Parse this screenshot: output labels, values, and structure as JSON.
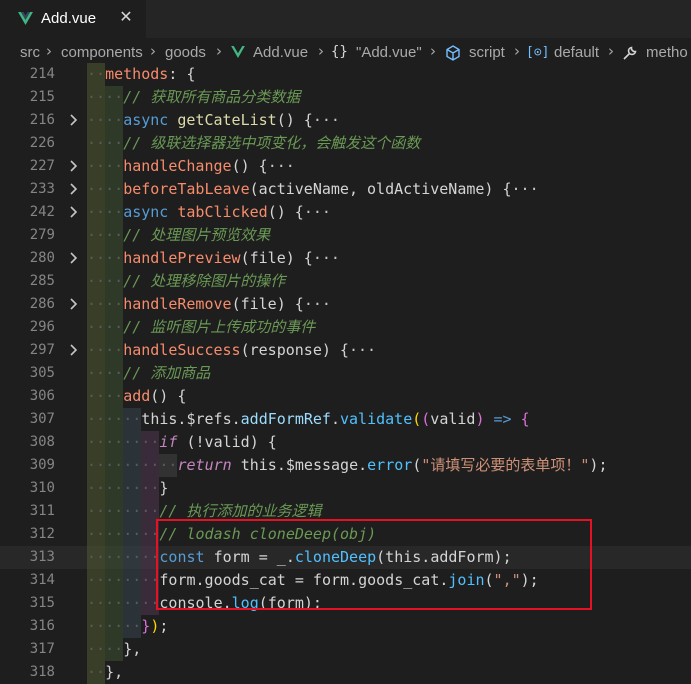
{
  "tab": {
    "label": "Add.vue",
    "close": "✕"
  },
  "breadcrumb": {
    "parts": [
      "src",
      "components",
      "goods",
      "Add.vue",
      "\"Add.vue\"",
      "script",
      "default",
      "metho"
    ]
  },
  "colors": {
    "vue_green": "#41b883",
    "highlight_box": "#e81123"
  },
  "lines": [
    {
      "num": "214",
      "indent": 1,
      "fold": false,
      "tokens": [
        [
          "methods",
          "pink"
        ],
        [
          ": {",
          "plain"
        ]
      ]
    },
    {
      "num": "215",
      "indent": 2,
      "fold": false,
      "tokens": [
        [
          "// 获取所有商品分类数据",
          "cmt"
        ]
      ]
    },
    {
      "num": "216",
      "indent": 2,
      "fold": true,
      "tokens": [
        [
          "async ",
          "kw"
        ],
        [
          "getCateList",
          "fn"
        ],
        [
          "() {",
          "plain"
        ],
        [
          "···",
          "fold-ellipsis"
        ]
      ]
    },
    {
      "num": "226",
      "indent": 2,
      "fold": false,
      "tokens": [
        [
          "// 级联选择器选中项变化，会触发这个函数",
          "cmt"
        ]
      ]
    },
    {
      "num": "227",
      "indent": 2,
      "fold": true,
      "tokens": [
        [
          "handleChange",
          "pink"
        ],
        [
          "() {",
          "plain"
        ],
        [
          "···",
          "fold-ellipsis"
        ]
      ]
    },
    {
      "num": "233",
      "indent": 2,
      "fold": true,
      "tokens": [
        [
          "beforeTabLeave",
          "pink"
        ],
        [
          "(activeName, oldActiveName) {",
          "plain"
        ],
        [
          "···",
          "fold-ellipsis"
        ]
      ]
    },
    {
      "num": "242",
      "indent": 2,
      "fold": true,
      "tokens": [
        [
          "async ",
          "kw"
        ],
        [
          "tabClicked",
          "pink"
        ],
        [
          "() {",
          "plain"
        ],
        [
          "···",
          "fold-ellipsis"
        ]
      ]
    },
    {
      "num": "279",
      "indent": 2,
      "fold": false,
      "tokens": [
        [
          "// 处理图片预览效果",
          "cmt"
        ]
      ]
    },
    {
      "num": "280",
      "indent": 2,
      "fold": true,
      "tokens": [
        [
          "handlePreview",
          "pink"
        ],
        [
          "(file) {",
          "plain"
        ],
        [
          "···",
          "fold-ellipsis"
        ]
      ]
    },
    {
      "num": "285",
      "indent": 2,
      "fold": false,
      "tokens": [
        [
          "// 处理移除图片的操作",
          "cmt"
        ]
      ]
    },
    {
      "num": "286",
      "indent": 2,
      "fold": true,
      "tokens": [
        [
          "handleRemove",
          "pink"
        ],
        [
          "(file) {",
          "plain"
        ],
        [
          "···",
          "fold-ellipsis"
        ]
      ]
    },
    {
      "num": "296",
      "indent": 2,
      "fold": false,
      "tokens": [
        [
          "// 监听图片上传成功的事件",
          "cmt"
        ]
      ]
    },
    {
      "num": "297",
      "indent": 2,
      "fold": true,
      "tokens": [
        [
          "handleSuccess",
          "pink"
        ],
        [
          "(response) {",
          "plain"
        ],
        [
          "···",
          "fold-ellipsis"
        ]
      ]
    },
    {
      "num": "305",
      "indent": 2,
      "fold": false,
      "tokens": [
        [
          "// 添加商品",
          "cmt"
        ]
      ]
    },
    {
      "num": "306",
      "indent": 2,
      "fold": false,
      "tokens": [
        [
          "add",
          "pink"
        ],
        [
          "() {",
          "plain"
        ]
      ]
    },
    {
      "num": "307",
      "indent": 3,
      "fold": false,
      "tokens": [
        [
          "this",
          "plain"
        ],
        [
          ".$refs.",
          "plain"
        ],
        [
          "addFormRef",
          "prop"
        ],
        [
          ".",
          "plain"
        ],
        [
          "validate",
          "meth"
        ],
        [
          "(",
          "br1"
        ],
        [
          "(",
          "br2"
        ],
        [
          "valid",
          "plain"
        ],
        [
          ")",
          "br2"
        ],
        [
          " => ",
          "kw"
        ],
        [
          "{",
          "br2"
        ]
      ]
    },
    {
      "num": "308",
      "indent": 4,
      "fold": false,
      "tokens": [
        [
          "if",
          "ctrl"
        ],
        [
          " (!valid) ",
          "plain"
        ],
        [
          "{",
          "plain"
        ]
      ]
    },
    {
      "num": "309",
      "indent": 5,
      "fold": false,
      "tokens": [
        [
          "return",
          "ctrl"
        ],
        [
          " this.",
          "plain"
        ],
        [
          "$message",
          "plain"
        ],
        [
          ".",
          "plain"
        ],
        [
          "error",
          "meth"
        ],
        [
          "(",
          "plain"
        ],
        [
          "\"请填写必要的表单项！\"",
          "str"
        ],
        [
          ");",
          "plain"
        ]
      ]
    },
    {
      "num": "310",
      "indent": 4,
      "fold": false,
      "tokens": [
        [
          "}",
          "plain"
        ]
      ]
    },
    {
      "num": "311",
      "indent": 4,
      "fold": false,
      "tokens": [
        [
          "// 执行添加的业务逻辑",
          "cmt"
        ]
      ]
    },
    {
      "num": "312",
      "indent": 4,
      "fold": false,
      "tokens": [
        [
          "// lodash cloneDeep(obj)",
          "cmt"
        ]
      ]
    },
    {
      "num": "313",
      "indent": 4,
      "fold": false,
      "current": true,
      "tokens": [
        [
          "const ",
          "kw"
        ],
        [
          "form",
          "plain"
        ],
        [
          " = _.",
          "plain"
        ],
        [
          "cloneDeep",
          "meth"
        ],
        [
          "(this.addForm);",
          "plain"
        ]
      ]
    },
    {
      "num": "314",
      "indent": 4,
      "fold": false,
      "tokens": [
        [
          "form",
          "plain"
        ],
        [
          ".goods_cat = ",
          "plain"
        ],
        [
          "form",
          "plain"
        ],
        [
          ".goods_cat.",
          "plain"
        ],
        [
          "join",
          "meth"
        ],
        [
          "(",
          "plain"
        ],
        [
          "\",\"",
          "str"
        ],
        [
          ");",
          "plain"
        ]
      ]
    },
    {
      "num": "315",
      "indent": 4,
      "fold": false,
      "tokens": [
        [
          "console",
          "plain"
        ],
        [
          ".",
          "plain"
        ],
        [
          "log",
          "meth"
        ],
        [
          "(form);",
          "plain"
        ]
      ]
    },
    {
      "num": "316",
      "indent": 3,
      "fold": false,
      "tokens": [
        [
          "}",
          "br2"
        ],
        [
          ")",
          "br1"
        ],
        [
          ";",
          "plain"
        ]
      ]
    },
    {
      "num": "317",
      "indent": 2,
      "fold": false,
      "tokens": [
        [
          "},",
          "plain"
        ]
      ]
    },
    {
      "num": "318",
      "indent": 1,
      "fold": false,
      "tokens": [
        [
          "},",
          "plain"
        ]
      ]
    }
  ]
}
